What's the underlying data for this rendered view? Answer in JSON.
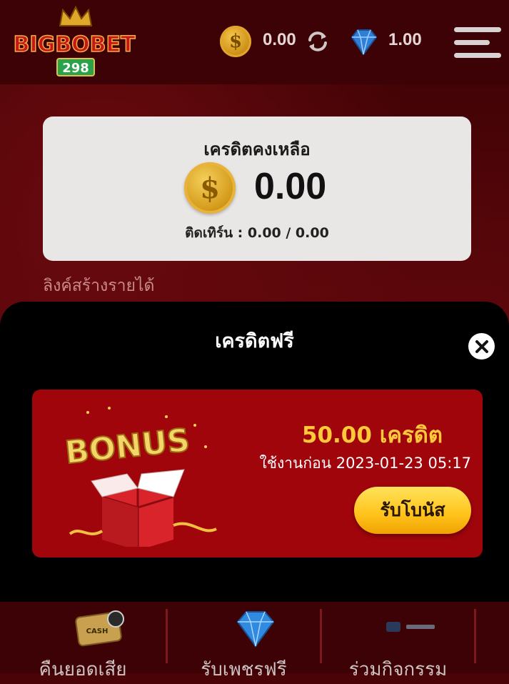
{
  "header": {
    "logo_text": "BIGBOBET",
    "logo_sub": "298",
    "credit_balance": "0.00",
    "gem_balance": "1.00",
    "icons": [
      "coin-icon",
      "refresh-icon",
      "gem-icon",
      "menu-icon"
    ]
  },
  "credit_card": {
    "title": "เครดิตคงเหลือ",
    "amount": "0.00",
    "turnover": "ติดเทิร์น : 0.00 / 0.00"
  },
  "earn_link": "ลิงค์สร้างรายได้",
  "modal": {
    "title": "เครดิตฟรี",
    "bonus": {
      "art_text": "BONUS",
      "amount": "50.00 เครดิต",
      "expiry": "ใช้งานก่อน 2023-01-23 05:17",
      "claim_label": "รับโบนัส"
    }
  },
  "bottom_nav": [
    {
      "label": "คืนยอดเสีย",
      "icon": "cashback-icon"
    },
    {
      "label": "รับเพชรฟรี",
      "icon": "diamond-icon"
    },
    {
      "label": "ร่วมกิจกรรม",
      "icon": "tech-icon"
    }
  ],
  "colors": {
    "background": "#4a0306",
    "card": "#e9e6e6",
    "bonus_card": "#a0050c",
    "bonus_amount": "#ffc93a",
    "claim_button": "#ffc21a"
  }
}
